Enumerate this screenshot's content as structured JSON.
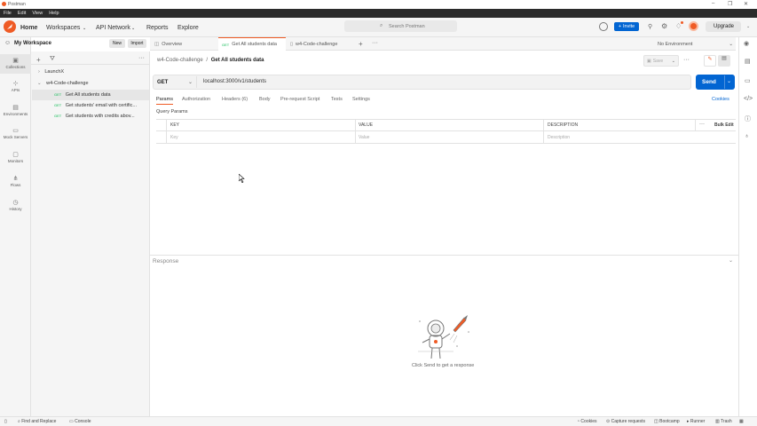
{
  "window": {
    "title": "Postman"
  },
  "menu": [
    "File",
    "Edit",
    "View",
    "Help"
  ],
  "header": {
    "nav": [
      "Home",
      "Workspaces",
      "API Network",
      "Reports",
      "Explore"
    ],
    "search_placeholder": "Search Postman",
    "invite": "Invite",
    "upgrade": "Upgrade"
  },
  "sidebar": {
    "workspace": "My Workspace",
    "new_label": "New",
    "import_label": "Import",
    "icons": [
      {
        "label": "Collections",
        "icon": "collections-icon"
      },
      {
        "label": "APIs",
        "icon": "apis-icon"
      },
      {
        "label": "Environments",
        "icon": "environments-icon"
      },
      {
        "label": "Mock Servers",
        "icon": "mock-servers-icon"
      },
      {
        "label": "Monitors",
        "icon": "monitors-icon"
      },
      {
        "label": "Flows",
        "icon": "flows-icon"
      },
      {
        "label": "History",
        "icon": "history-icon"
      }
    ],
    "tree": [
      {
        "label": "LaunchX"
      },
      {
        "label": "w4-Code-challenge"
      },
      {
        "method": "GET",
        "label": "Get All students data"
      },
      {
        "method": "GET",
        "label": "Get students' email with certific..."
      },
      {
        "method": "GET",
        "label": "Get students with credits abov..."
      }
    ]
  },
  "tabs": {
    "overview": "Overview",
    "active_method": "GET",
    "active": "Get All students data",
    "second": "w4-Code-challenge",
    "environment": "No Environment"
  },
  "request": {
    "breadcrumb_parent": "w4-Code-challenge",
    "breadcrumb_sep": "/",
    "breadcrumb_current": "Get All students data",
    "save": "Save",
    "method": "GET",
    "url": "localhost:3000/v1/students",
    "send": "Send",
    "subtabs": [
      "Params",
      "Authorization",
      "Headers (6)",
      "Body",
      "Pre-request Script",
      "Tests",
      "Settings"
    ],
    "cookies": "Cookies",
    "query_params": "Query Params",
    "columns": [
      "KEY",
      "VALUE",
      "DESCRIPTION"
    ],
    "bulk_edit": "Bulk Edit",
    "placeholders": [
      "Key",
      "Value",
      "Description"
    ]
  },
  "response": {
    "title": "Response",
    "empty_text": "Click Send to get a response"
  },
  "footer": {
    "find_replace": "Find and Replace",
    "console": "Console",
    "cookies": "Cookies",
    "capture": "Capture requests",
    "bootcamp": "Bootcamp",
    "runner": "Runner",
    "trash": "Trash"
  },
  "colors": {
    "accent": "#ef5b25",
    "primary": "#0265d2",
    "get": "#0cbb52"
  }
}
